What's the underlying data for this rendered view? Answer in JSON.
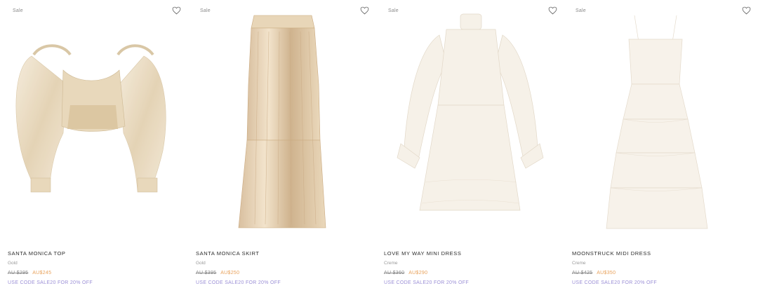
{
  "products": [
    {
      "badge": "Sale",
      "name": "SANTA MONICA TOP",
      "color": "Gold",
      "old_price": "AU $295",
      "new_price": "AU$245",
      "promo": "USE CODE SALE20 FOR 20% OFF",
      "icon": "heart-outline-icon"
    },
    {
      "badge": "Sale",
      "name": "SANTA MONICA SKIRT",
      "color": "Gold",
      "old_price": "AU $395",
      "new_price": "AU$250",
      "promo": "USE CODE SALE20 FOR 20% OFF",
      "icon": "heart-outline-icon"
    },
    {
      "badge": "Sale",
      "name": "LOVE MY WAY MINI DRESS",
      "color": "Creme",
      "old_price": "AU $360",
      "new_price": "AU$290",
      "promo": "USE CODE SALE20 FOR 20% OFF",
      "icon": "heart-outline-icon"
    },
    {
      "badge": "Sale",
      "name": "MOONSTRUCK MIDI DRESS",
      "color": "Creme",
      "old_price": "AU $425",
      "new_price": "AU$350",
      "promo": "USE CODE SALE20 FOR 20% OFF",
      "icon": "heart-outline-icon"
    }
  ],
  "colors": {
    "sale_price": "#e8a15a",
    "promo": "#9b8fd6",
    "muted": "#8a8a8a",
    "gold_fabric": "#e6d3b3",
    "creme_fabric": "#f4efe6"
  }
}
